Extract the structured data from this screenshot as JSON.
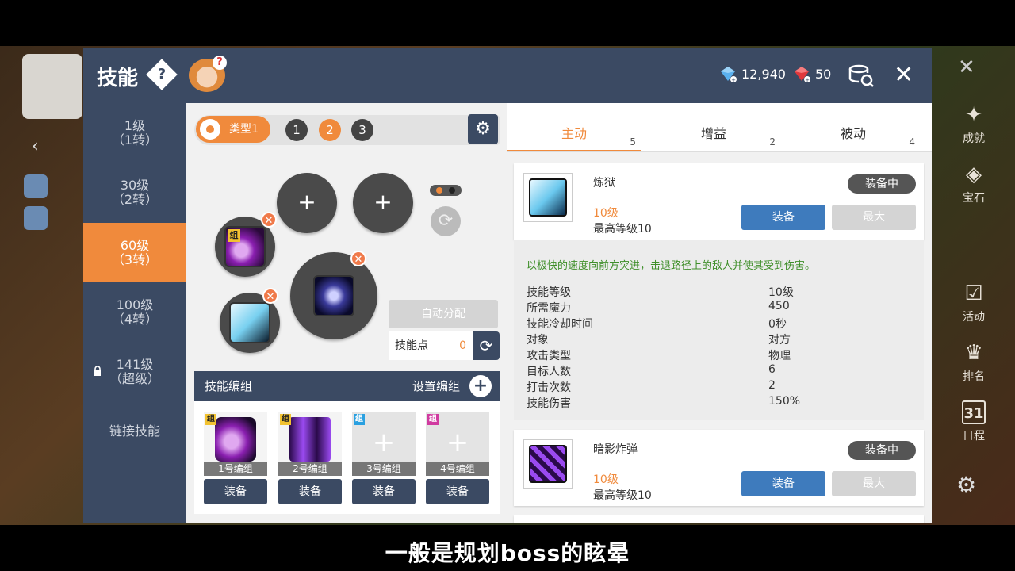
{
  "header": {
    "title": "技能",
    "help_icon": "?",
    "currency_blue": "12,940",
    "currency_red": "50",
    "close": "✕"
  },
  "background": {
    "right_items": [
      "成就",
      "宝石",
      "活动",
      "排名",
      "日程"
    ],
    "calendar_day": "31"
  },
  "sidebar": {
    "items": [
      {
        "label1": "1级",
        "label2": "（1转）"
      },
      {
        "label1": "30级",
        "label2": "（2转）"
      },
      {
        "label1": "60级",
        "label2": "（3转）"
      },
      {
        "label1": "100级",
        "label2": "（4转）"
      },
      {
        "label1": "141级",
        "label2": "（超级）"
      },
      {
        "label1": "链接技能",
        "label2": ""
      }
    ],
    "active_index": 2
  },
  "center": {
    "type_label": "类型1",
    "presets": [
      "1",
      "2",
      "3"
    ],
    "active_preset": "2",
    "plus": "+",
    "group_tag": "组",
    "auto_assign": "自动分配",
    "skill_points_label": "技能点",
    "skill_points_value": "0",
    "groups": {
      "title": "技能编组",
      "set_label": "设置编组",
      "cards": [
        {
          "label": "1号编组",
          "tag": "组"
        },
        {
          "label": "2号编组",
          "tag": "组"
        },
        {
          "label": "3号编组",
          "tag": "组"
        },
        {
          "label": "4号编组",
          "tag": "组"
        }
      ],
      "equip_label": "装备"
    }
  },
  "right": {
    "tabs": [
      {
        "label": "主动",
        "count": "5"
      },
      {
        "label": "增益",
        "count": "2"
      },
      {
        "label": "被动",
        "count": "4"
      }
    ],
    "skills": [
      {
        "name": "炼狱",
        "level": "10级",
        "max_level": "最高等级10",
        "equipped_badge": "装备中",
        "equip": "装备",
        "max": "最大"
      },
      {
        "name": "暗影炸弹",
        "level": "10级",
        "max_level": "最高等级10",
        "equipped_badge": "装备中",
        "equip": "装备",
        "max": "最大"
      }
    ],
    "detail": {
      "description": "以极快的速度向前方突进，击退路径上的敌人并使其受到伤害。",
      "stats": [
        {
          "k": "技能等级",
          "v": "10级"
        },
        {
          "k": "所需魔力",
          "v": "450"
        },
        {
          "k": "技能冷却时间",
          "v": "0秒"
        },
        {
          "k": "对象",
          "v": "对方"
        },
        {
          "k": "攻击类型",
          "v": "物理"
        },
        {
          "k": "目标人数",
          "v": "6"
        },
        {
          "k": "打击次数",
          "v": "2"
        },
        {
          "k": "技能伤害",
          "v": "150%"
        }
      ]
    }
  },
  "subtitle": "一般是规划boss的眩晕"
}
